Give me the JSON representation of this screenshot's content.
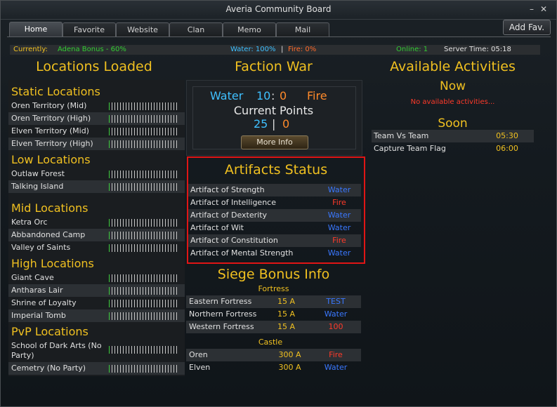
{
  "window": {
    "title": "Averia Community Board"
  },
  "tabs": [
    {
      "label": "Home",
      "active": true
    },
    {
      "label": "Favorite"
    },
    {
      "label": "Website"
    },
    {
      "label": "Clan"
    },
    {
      "label": "Memo"
    },
    {
      "label": "Mail"
    }
  ],
  "add_fav_label": "Add Fav.",
  "status": {
    "currently_label": "Currently:",
    "currently_value": "Adena Bonus - 60%",
    "water": "Water: 100%",
    "separator": "|",
    "fire": "Fire: 0%",
    "online": "Online: 1",
    "server_time": "Server Time: 05:18"
  },
  "locations": {
    "heading": "Locations Loaded",
    "groups": [
      {
        "title": "Static Locations",
        "items": [
          {
            "name": "Oren Territory (Mid)",
            "fill": 0.05
          },
          {
            "name": "Oren Territory (High)",
            "fill": 0.05
          },
          {
            "name": "Elven Territory (Mid)",
            "fill": 0.05
          },
          {
            "name": "Elven Territory (High)",
            "fill": 0.05
          }
        ]
      },
      {
        "title": "Low Locations",
        "items": [
          {
            "name": "Outlaw Forest",
            "fill": 0.05
          },
          {
            "name": "Talking Island",
            "fill": 0.05
          }
        ]
      },
      {
        "title": "Mid Locations",
        "items": [
          {
            "name": "Ketra Orc",
            "fill": 0.05
          },
          {
            "name": "Abbandoned Camp",
            "fill": 0.05
          },
          {
            "name": "Valley of Saints",
            "fill": 0.05
          }
        ]
      },
      {
        "title": "High Locations",
        "items": [
          {
            "name": "Giant Cave",
            "fill": 0.05
          },
          {
            "name": "Antharas Lair",
            "fill": 0.05
          },
          {
            "name": "Shrine of Loyalty",
            "fill": 0.05
          },
          {
            "name": "Imperial Tomb",
            "fill": 0.05
          }
        ]
      },
      {
        "title": "PvP Locations",
        "items": [
          {
            "name": "School of Dark Arts (No Party)",
            "fill": 0.05
          },
          {
            "name": "Cemetry (No Party)",
            "fill": 0.05
          }
        ]
      }
    ]
  },
  "faction_war": {
    "heading": "Faction War",
    "water_label": "Water",
    "water_score": "10",
    "colon": ":",
    "fire_score": "0",
    "fire_label": "Fire",
    "points_title": "Current Points",
    "water_points": "25",
    "divider": "|",
    "fire_points": "0",
    "more_info": "More Info"
  },
  "artifacts": {
    "heading": "Artifacts Status",
    "items": [
      {
        "name": "Artifact of Strength",
        "owner": "Water"
      },
      {
        "name": "Artifact of Intelligence",
        "owner": "Fire"
      },
      {
        "name": "Artifact of Dexterity",
        "owner": "Water"
      },
      {
        "name": "Artifact of Wit",
        "owner": "Water"
      },
      {
        "name": "Artifact of Constitution",
        "owner": "Fire"
      },
      {
        "name": "Artifact of Mental Strength",
        "owner": "Water"
      }
    ]
  },
  "siege": {
    "heading": "Siege Bonus Info",
    "fortress_label": "Fortress",
    "fortresses": [
      {
        "name": "Eastern Fortress",
        "amount": "15 A",
        "owner": "TEST"
      },
      {
        "name": "Northern Fortress",
        "amount": "15 A",
        "owner": "Water"
      },
      {
        "name": "Western Fortress",
        "amount": "15 A",
        "owner": "100"
      }
    ],
    "castle_label": "Castle",
    "castles": [
      {
        "name": "Oren",
        "amount": "300 A",
        "owner": "Fire"
      },
      {
        "name": "Elven",
        "amount": "300 A",
        "owner": "Water"
      }
    ]
  },
  "activities": {
    "heading": "Available Activities",
    "now_label": "Now",
    "now_empty": "No available activities...",
    "soon_label": "Soon",
    "soon": [
      {
        "name": "Team Vs Team",
        "time": "05:30"
      },
      {
        "name": "Capture Team Flag",
        "time": "06:00"
      }
    ]
  },
  "colors": {
    "water": "#3a78ff",
    "fire": "#ff3a2a",
    "gold": "#f0c020",
    "highlight": "#e01515"
  },
  "icons": {
    "minimize": "minimize-icon",
    "close": "close-icon"
  }
}
